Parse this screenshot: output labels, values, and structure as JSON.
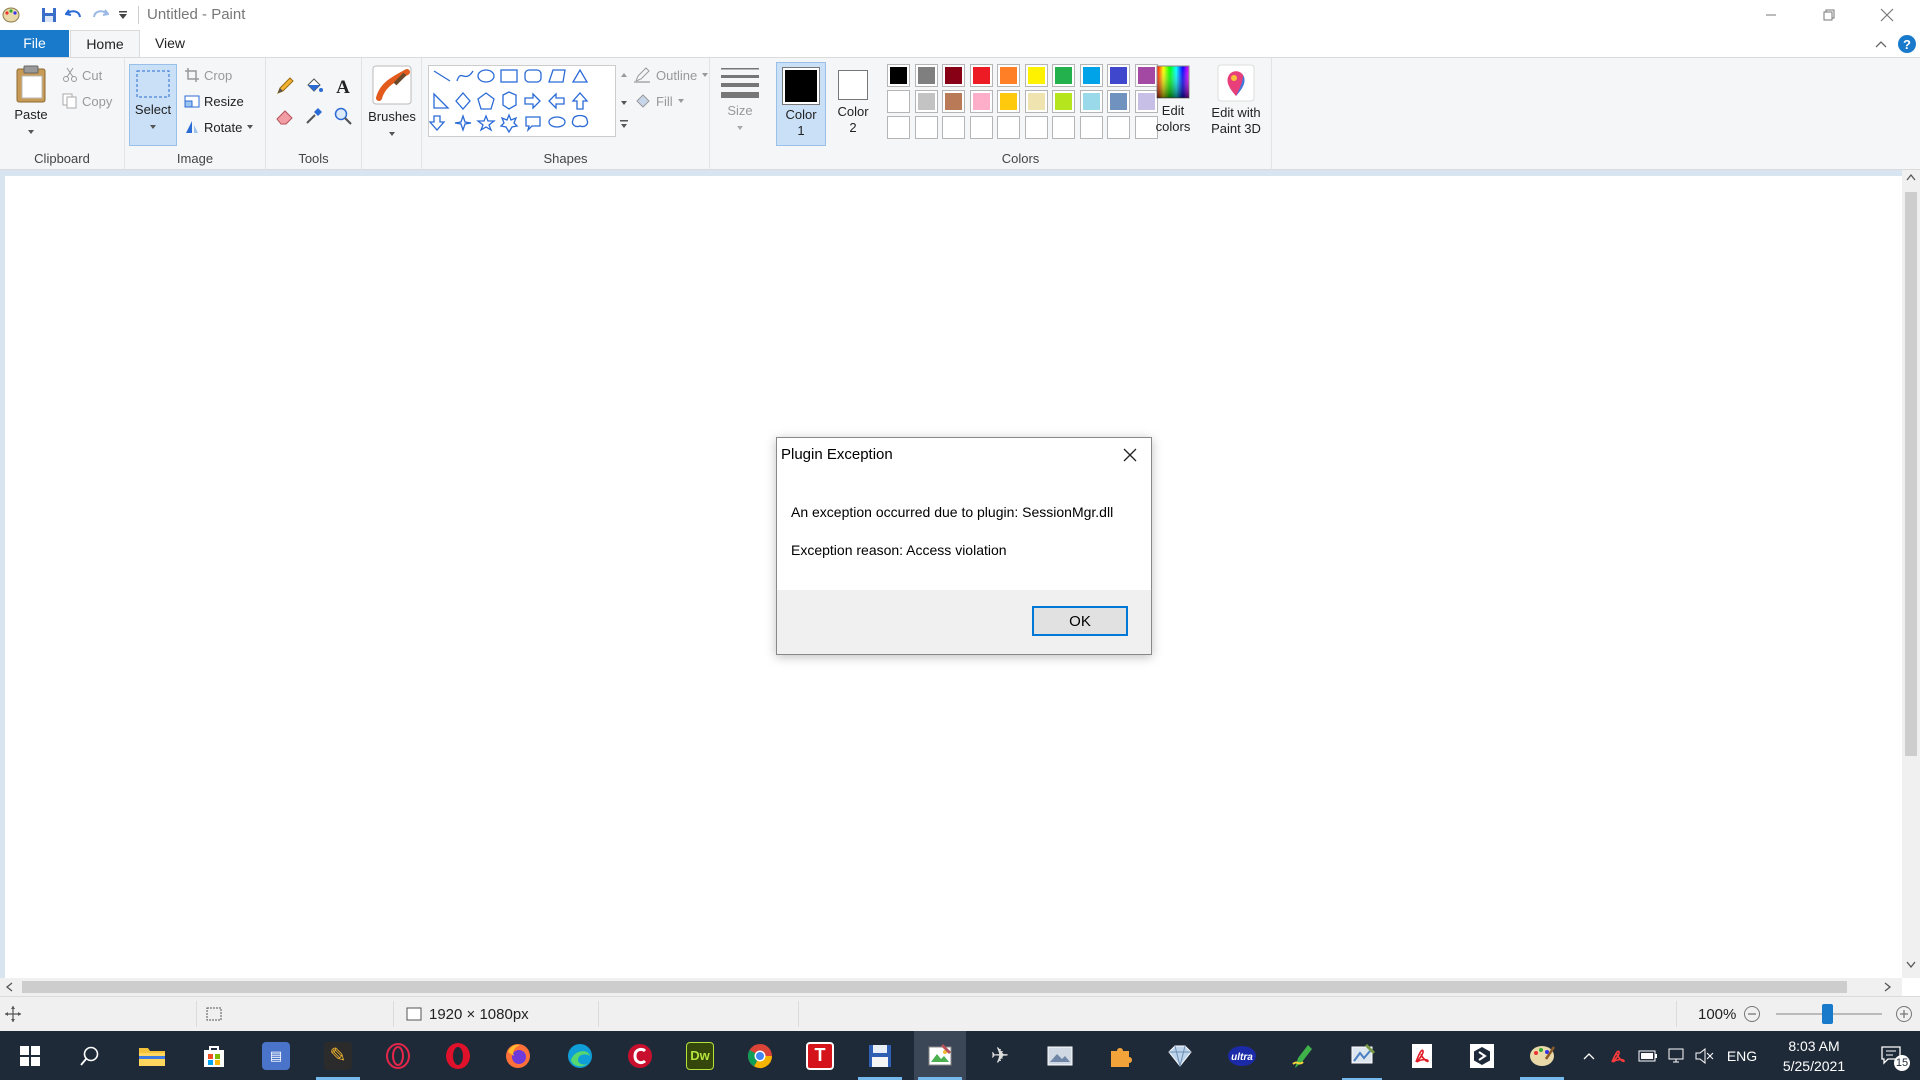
{
  "window": {
    "title": "Untitled - Paint"
  },
  "tabs": {
    "file": "File",
    "home": "Home",
    "view": "View"
  },
  "clipboard": {
    "paste": "Paste",
    "cut": "Cut",
    "copy": "Copy",
    "group": "Clipboard"
  },
  "image": {
    "select": "Select",
    "crop": "Crop",
    "resize": "Resize",
    "rotate": "Rotate",
    "group": "Image"
  },
  "tools": {
    "group": "Tools"
  },
  "brushes": {
    "label": "Brushes"
  },
  "shapes": {
    "outline": "Outline",
    "fill": "Fill",
    "group": "Shapes"
  },
  "size": {
    "label": "Size"
  },
  "colors": {
    "color1_line1": "Color",
    "color1_line2": "1",
    "color2_line1": "Color",
    "color2_line2": "2",
    "edit_line1": "Edit",
    "edit_line2": "colors",
    "group": "Colors",
    "color1_value": "#000000",
    "color2_value": "#ffffff",
    "palette_row1": [
      "#000000",
      "#7f7f7f",
      "#880015",
      "#ed1c24",
      "#ff7f27",
      "#fff200",
      "#22b14c",
      "#00a2e8",
      "#3f48cc",
      "#a349a4"
    ],
    "palette_row2": [
      "#ffffff",
      "#c3c3c3",
      "#b97a57",
      "#ffaec9",
      "#ffc90e",
      "#efe4b0",
      "#b5e61d",
      "#99d9ea",
      "#7092be",
      "#c8bfe7"
    ]
  },
  "paint3d": {
    "line1": "Edit with",
    "line2": "Paint 3D"
  },
  "status": {
    "canvas_size": "1920 × 1080px",
    "zoom": "100%"
  },
  "dialog": {
    "title": "Plugin Exception",
    "message1": "An exception occurred due to plugin: SessionMgr.dll",
    "message2": "Exception reason: Access violation",
    "ok": "OK"
  },
  "taskbar": {
    "lang": "ENG",
    "time": "8:03 AM",
    "date": "5/25/2021",
    "notifications": "15"
  }
}
